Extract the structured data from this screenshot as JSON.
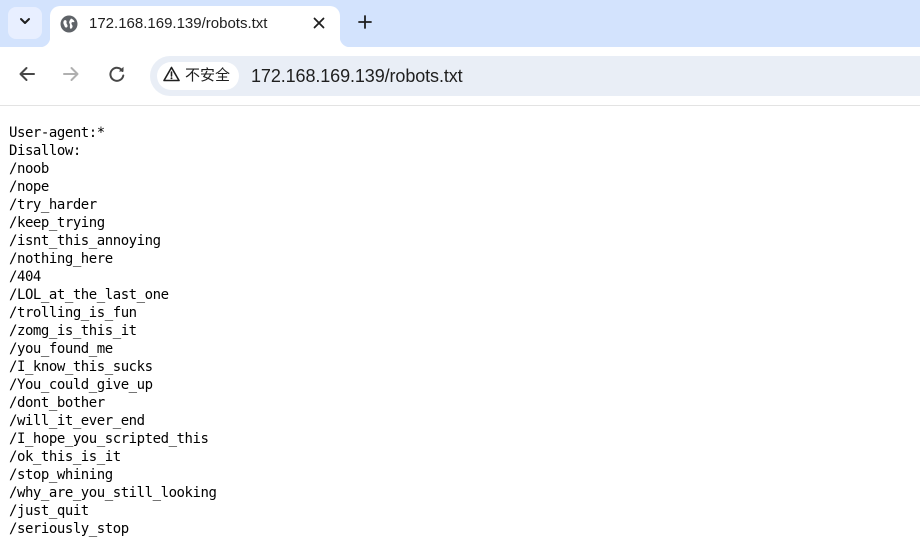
{
  "browser": {
    "tab": {
      "title": "172.168.169.139/robots.txt",
      "favicon": "globe-icon"
    },
    "icons": {
      "tab_dropdown": "chevron-down-icon",
      "tab_close": "close-icon",
      "new_tab": "plus-icon",
      "back": "back-arrow-icon",
      "forward": "forward-arrow-icon",
      "reload": "reload-icon",
      "security": "warning-icon"
    },
    "address_bar": {
      "security_label": "不安全",
      "url": "172.168.169.139/robots.txt"
    },
    "colors": {
      "tab_strip": "#d3e3fd",
      "omnibox": "#e9eef6",
      "active_tab": "#ffffff"
    }
  },
  "page": {
    "lines": [
      "User-agent:*",
      "Disallow:",
      "/noob",
      "/nope",
      "/try_harder",
      "/keep_trying",
      "/isnt_this_annoying",
      "/nothing_here",
      "/404",
      "/LOL_at_the_last_one",
      "/trolling_is_fun",
      "/zomg_is_this_it",
      "/you_found_me",
      "/I_know_this_sucks",
      "/You_could_give_up",
      "/dont_bother",
      "/will_it_ever_end",
      "/I_hope_you_scripted_this",
      "/ok_this_is_it",
      "/stop_whining",
      "/why_are_you_still_looking",
      "/just_quit",
      "/seriously_stop"
    ]
  }
}
